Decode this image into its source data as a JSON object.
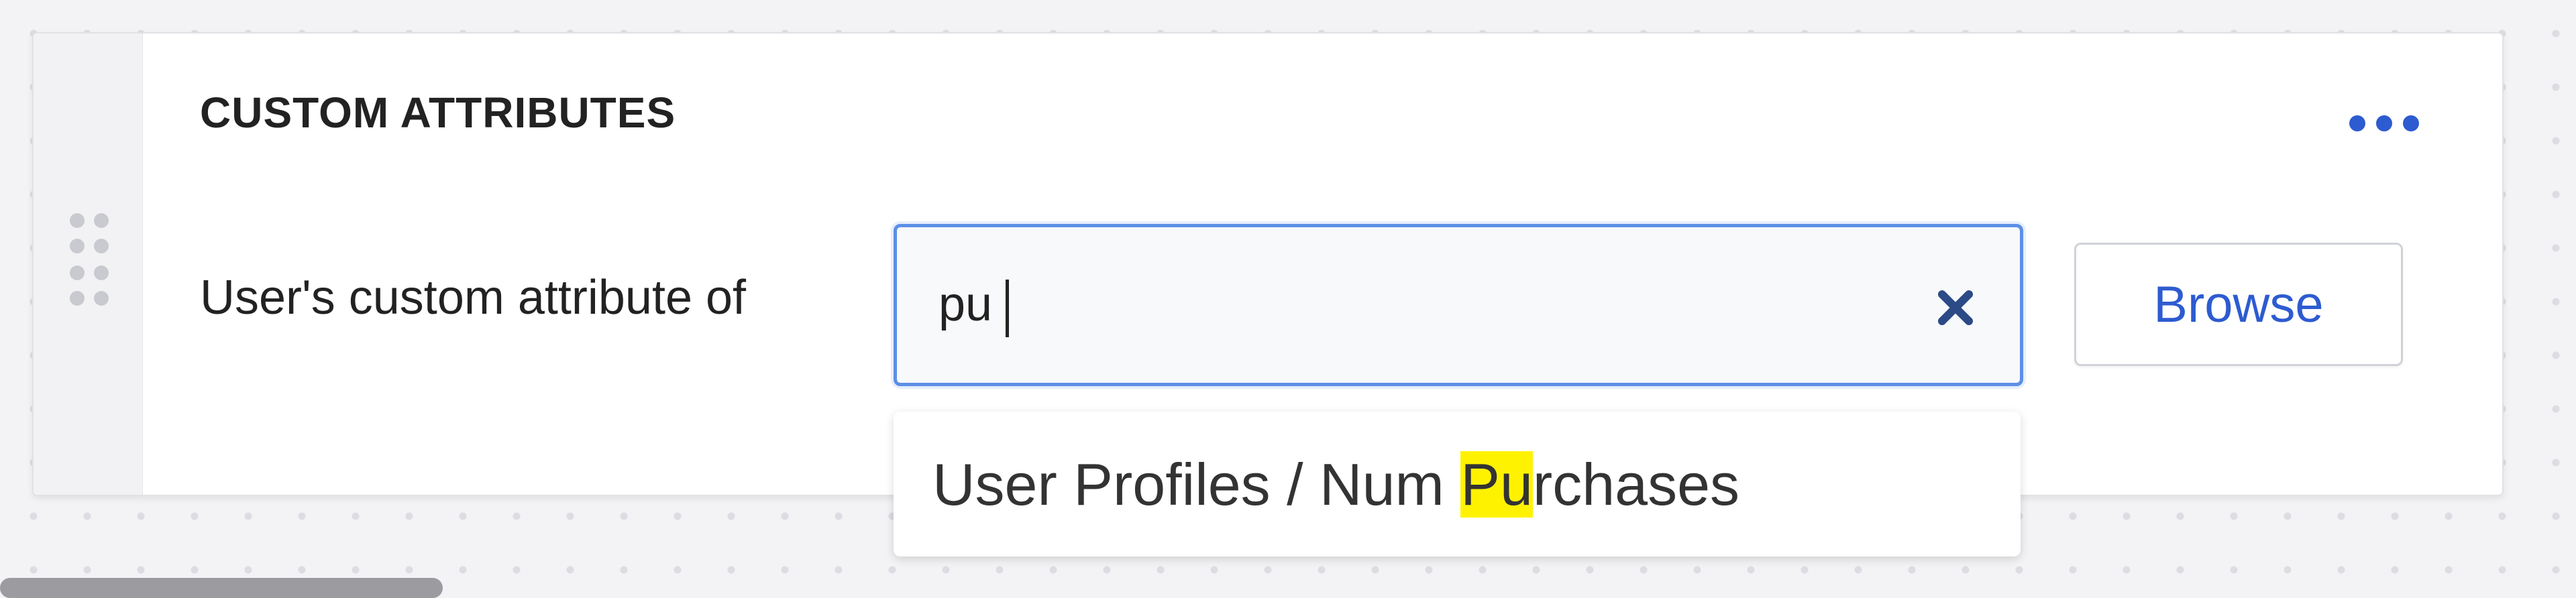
{
  "card": {
    "title": "CUSTOM ATTRIBUTES",
    "more_icon": "more-horizontal-icon",
    "drag_icon": "drag-handle-icon"
  },
  "filter": {
    "label": "User's custom attribute of",
    "search": {
      "value": "pu",
      "clear_icon": "close-icon"
    },
    "browse_label": "Browse"
  },
  "suggestions": [
    {
      "before": "User Profiles / Num ",
      "match": "Pu",
      "after": "rchases"
    }
  ],
  "colors": {
    "accent": "#2d5bd0",
    "focus_border": "#5c8fe6",
    "highlight": "#fff200"
  }
}
